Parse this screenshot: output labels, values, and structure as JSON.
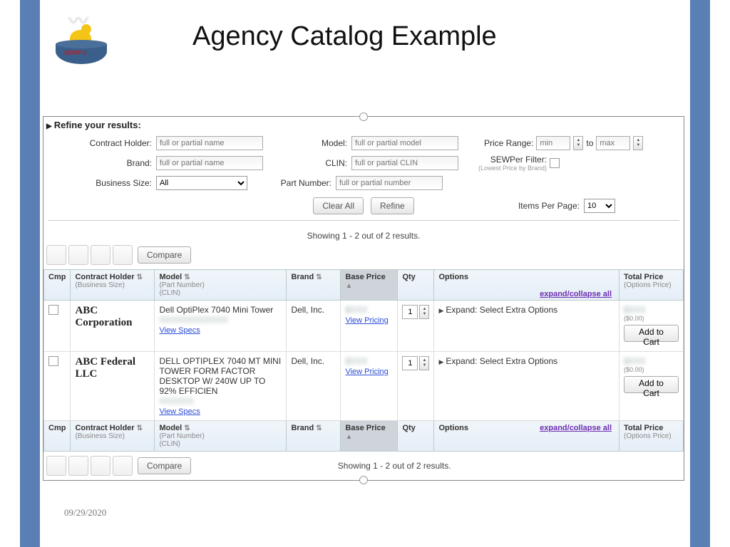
{
  "title": "Agency Catalog Example",
  "logo_label": "SEWP V",
  "date": "09/29/2020",
  "refine_header": "Refine your results:",
  "filters": {
    "contract_holder": {
      "label": "Contract Holder:",
      "placeholder": "full or partial name"
    },
    "brand": {
      "label": "Brand:",
      "placeholder": "full or partial name"
    },
    "business_size": {
      "label": "Business Size:",
      "value": "All"
    },
    "model": {
      "label": "Model:",
      "placeholder": "full or partial model"
    },
    "clin": {
      "label": "CLIN:",
      "placeholder": "full or partial CLIN"
    },
    "part_number": {
      "label": "Part Number:",
      "placeholder": "full or partial number"
    },
    "price_range": {
      "label": "Price Range:",
      "min_ph": "min",
      "to": "to",
      "max_ph": "max"
    },
    "sewper": {
      "label": "SEWPer Filter:",
      "hint": "(Lowest Price by Brand)"
    }
  },
  "buttons": {
    "clear_all": "Clear All",
    "refine": "Refine",
    "compare": "Compare",
    "add_to_cart": "Add to Cart"
  },
  "items_per_page": {
    "label": "Items Per Page:",
    "value": "10"
  },
  "showing": "Showing 1 - 2 out of 2 results.",
  "columns": {
    "cmp": "Cmp",
    "contract_holder": "Contract Holder",
    "contract_holder_sub": "(Business Size)",
    "model": "Model",
    "model_sub1": "(Part Number)",
    "model_sub2": "(CLIN)",
    "brand": "Brand",
    "base_price": "Base Price",
    "qty": "Qty",
    "options": "Options",
    "total_price": "Total Price",
    "total_price_sub": "(Options Price)"
  },
  "expand_collapse": "expand/collapse all",
  "rows": [
    {
      "vendor": "ABC Corporation",
      "model": "Dell OptiPlex 7040 Mini Tower",
      "view_specs": "View Specs",
      "brand": "Dell, Inc.",
      "view_pricing": "View Pricing",
      "qty": "1",
      "expand_text": "Expand: Select Extra Options",
      "opt_price": "($0.00)"
    },
    {
      "vendor": "ABC Federal LLC",
      "model": "DELL OPTIPLEX 7040 MT MINI TOWER FORM FACTOR DESKTOP W/ 240W UP TO 92% EFFICIEN",
      "view_specs": "View Specs",
      "brand": "Dell, Inc.",
      "view_pricing": "View Pricing",
      "qty": "1",
      "expand_text": "Expand: Select Extra Options",
      "opt_price": "($0.00)"
    }
  ]
}
